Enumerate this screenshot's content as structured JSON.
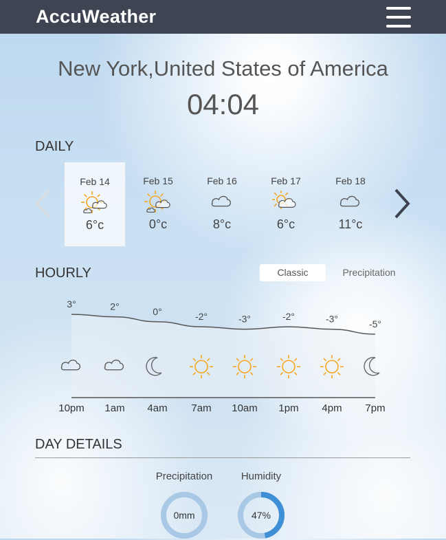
{
  "header": {
    "brand": "AccuWeather",
    "menu_icon": "hamburger-menu-icon"
  },
  "location": {
    "city": "New York,United States of America",
    "time": "04:04"
  },
  "daily": {
    "title": "DAILY",
    "days": [
      {
        "date": "Feb 14",
        "temp": "6°c",
        "icon": "partly-sunny-icon",
        "selected": true
      },
      {
        "date": "Feb 15",
        "temp": "0°c",
        "icon": "partly-sunny-icon",
        "selected": false
      },
      {
        "date": "Feb 16",
        "temp": "8°c",
        "icon": "cloud-icon",
        "selected": false
      },
      {
        "date": "Feb 17",
        "temp": "6°c",
        "icon": "sun-behind-cloud-icon",
        "selected": false
      },
      {
        "date": "Feb 18",
        "temp": "11°c",
        "icon": "cloud-icon",
        "selected": false
      }
    ]
  },
  "hourly": {
    "title": "HOURLY",
    "tabs": [
      "Classic",
      "Precipitation"
    ],
    "active_tab": "Classic",
    "times": [
      "10pm",
      "1am",
      "4am",
      "7am",
      "10am",
      "1pm",
      "4pm",
      "7pm"
    ],
    "temp_labels": [
      "3°",
      "2°",
      "0°",
      "-2°",
      "-3°",
      "-2°",
      "-3°",
      "-5°"
    ],
    "temps": [
      3,
      2,
      0,
      -2,
      -3,
      -2,
      -3,
      -5
    ],
    "icons": [
      "cloud-icon",
      "cloud-icon",
      "moon-icon",
      "sun-icon",
      "sun-icon",
      "sun-icon",
      "sun-icon",
      "moon-icon"
    ]
  },
  "day_details": {
    "title": "DAY DETAILS",
    "precipitation": {
      "label": "Precipitation",
      "value": "0mm",
      "fraction": 0
    },
    "humidity": {
      "label": "Humidity",
      "value": "47%",
      "fraction": 0.47
    }
  },
  "colors": {
    "topbar": "#3e4452",
    "sun": "#f5a623",
    "gauge_track": "#a8c8e6",
    "gauge_fill": "#3f8fd6"
  }
}
